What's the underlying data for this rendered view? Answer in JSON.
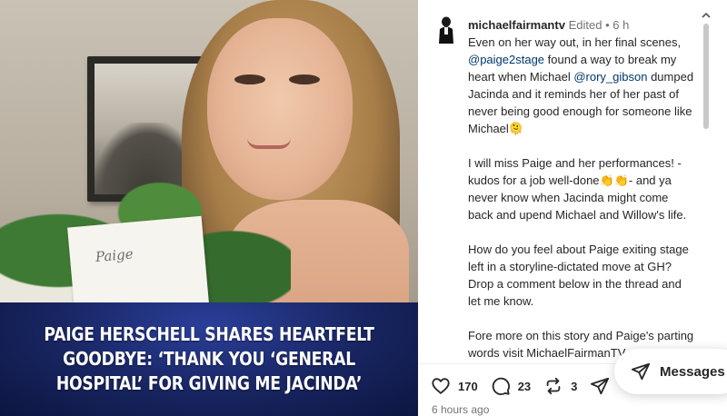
{
  "post": {
    "banner_title": "Paige Herschell Shares Heartfelt Goodbye: ‘Thank You ‘General Hospital’ for Giving Me Jacinda’",
    "card_text": "Paige"
  },
  "comment": {
    "username": "michaelfairmantv",
    "edited": "Edited",
    "separator": "•",
    "time": "6 h",
    "p1_a": "Even on her way out, in her final scenes, ",
    "p1_mention1": "@paige2stage",
    "p1_b": " found a way to break my heart when Michael ",
    "p1_mention2": "@rory_gibson",
    "p1_c": " dumped Jacinda and it reminds her of her past of never being good enough for someone like Michael🫠",
    "p2_a": "I will miss Paige and her performances! - kudos for a job well-done",
    "p2_emoji": "👏👏",
    "p2_b": "- and ya never know when Jacinda might come back and upend Michael and Willow's life.",
    "p3": "How do you feel about Paige exiting stage left in a storyline-dictated move at GH? Drop a comment below in the thread and let me know.",
    "p4": "Fore more on this story and Paige's parting words visit MichaelFairmanTV.com."
  },
  "actions": {
    "likes": "170",
    "comments": "23",
    "reposts": "3"
  },
  "time_ago": "6 hours ago",
  "messages_button": {
    "label": "Messages"
  },
  "icons": {
    "like": "heart-icon",
    "comment": "comment-icon",
    "repost": "repost-icon",
    "share": "send-icon",
    "messages": "send-icon",
    "more": "chevron-up-icon"
  }
}
